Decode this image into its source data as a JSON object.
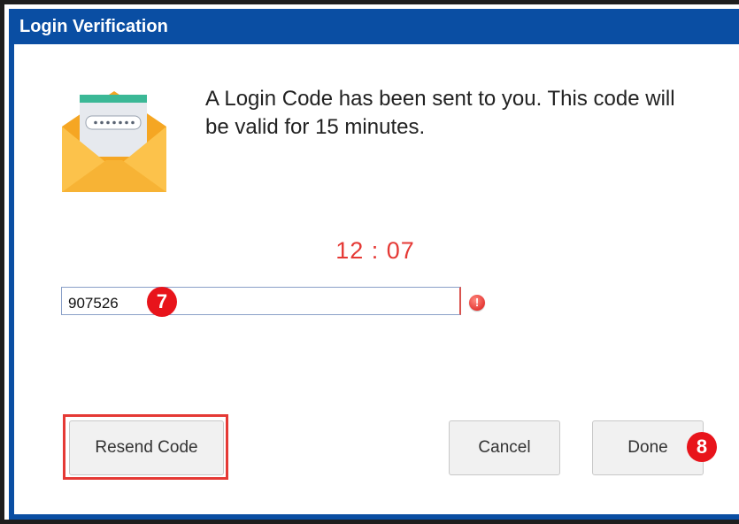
{
  "dialog": {
    "title": "Login Verification",
    "message": "A Login Code has been sent to you. This code will be valid for 15 minutes.",
    "timer": "12 : 07",
    "code_input": {
      "value": "907526",
      "placeholder": ""
    },
    "buttons": {
      "resend_label": "Resend Code",
      "cancel_label": "Cancel",
      "done_label": "Done"
    }
  },
  "annotations": {
    "step_input": "7",
    "step_done": "8"
  },
  "icons": {
    "envelope": "envelope-code-icon",
    "error": "error-exclamation-icon"
  },
  "colors": {
    "titlebar": "#0a4ea3",
    "timer": "#e53935",
    "badge": "#e8141b",
    "highlight": "#e53935"
  }
}
